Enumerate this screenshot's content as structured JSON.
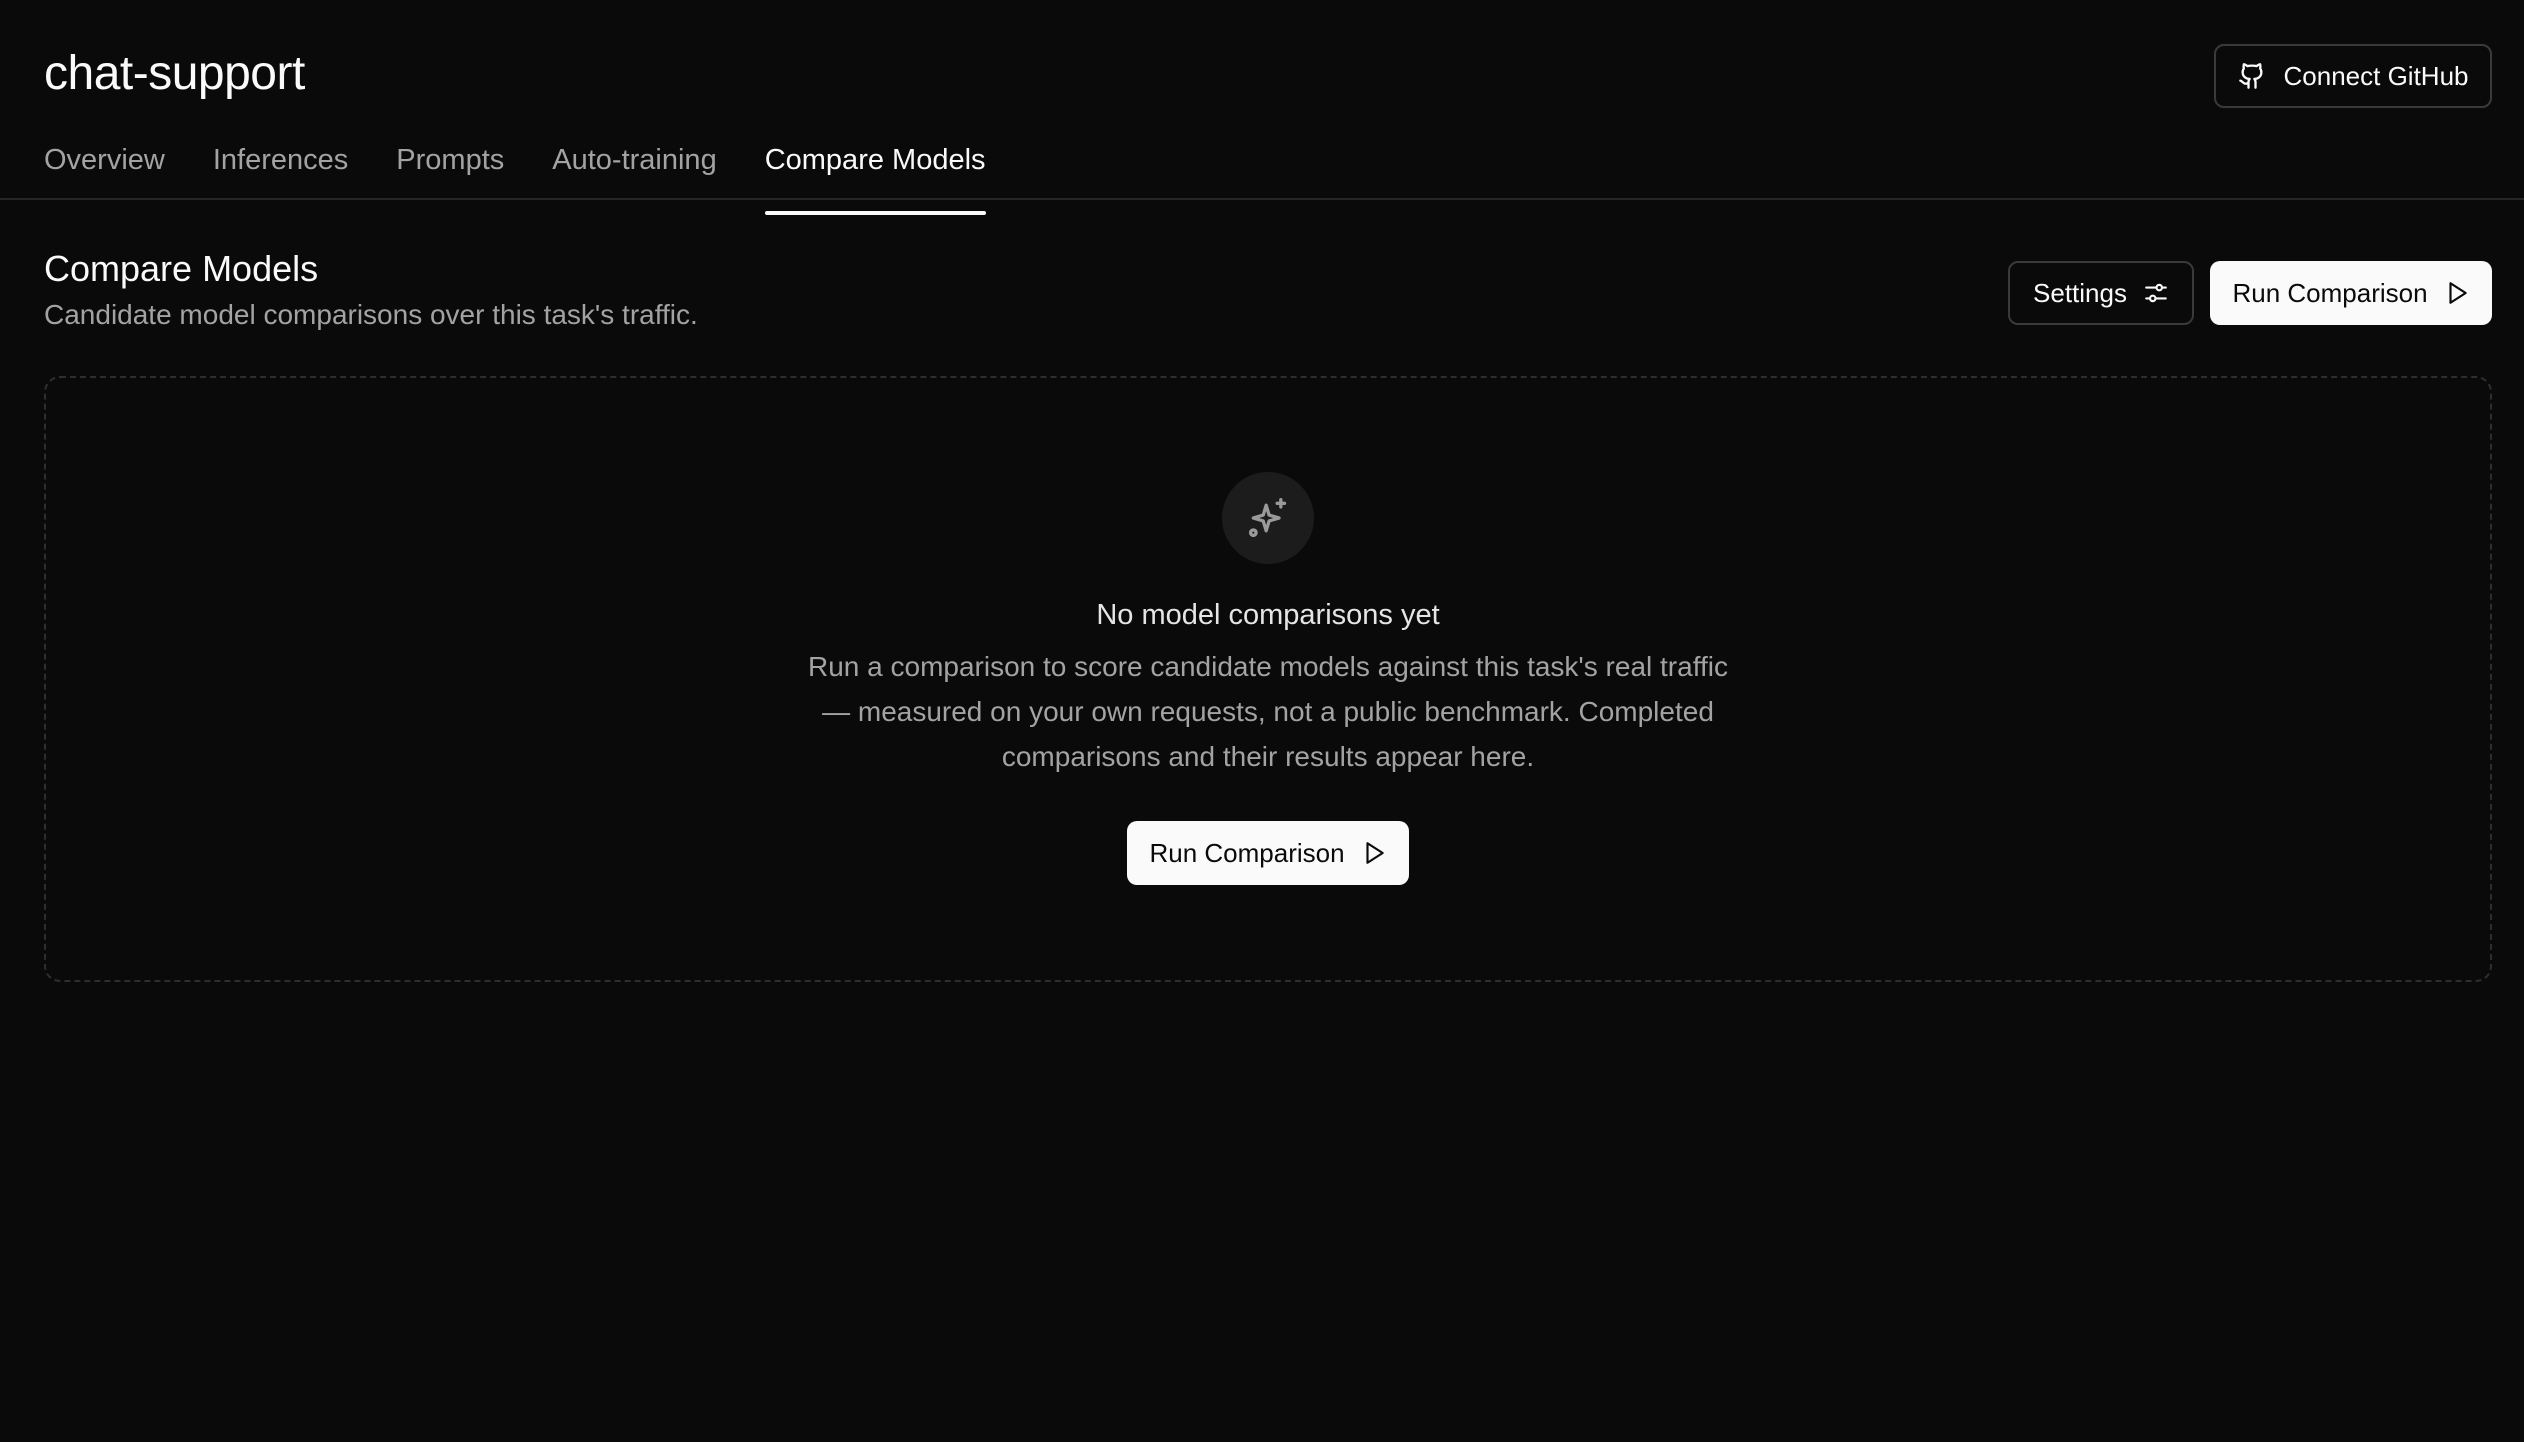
{
  "app": {
    "title": "chat-support"
  },
  "header": {
    "connect_github_label": "Connect GitHub"
  },
  "tabs": [
    {
      "label": "Overview",
      "active": false
    },
    {
      "label": "Inferences",
      "active": false
    },
    {
      "label": "Prompts",
      "active": false
    },
    {
      "label": "Auto-training",
      "active": false
    },
    {
      "label": "Compare Models",
      "active": true
    }
  ],
  "section": {
    "title": "Compare Models",
    "subtitle": "Candidate model comparisons over this task's traffic.",
    "settings_label": "Settings",
    "run_label": "Run Comparison"
  },
  "empty_state": {
    "icon": "sparkles-icon",
    "title": "No model comparisons yet",
    "description": "Run a comparison to score candidate models against this task's real traffic — measured on your own requests, not a public benchmark. Completed comparisons and their results appear here.",
    "run_label": "Run Comparison"
  },
  "colors": {
    "background": "#0a0a0a",
    "primary_button": "#fafafa",
    "muted_text": "#a3a3a3",
    "border": "#3a3a3a"
  }
}
